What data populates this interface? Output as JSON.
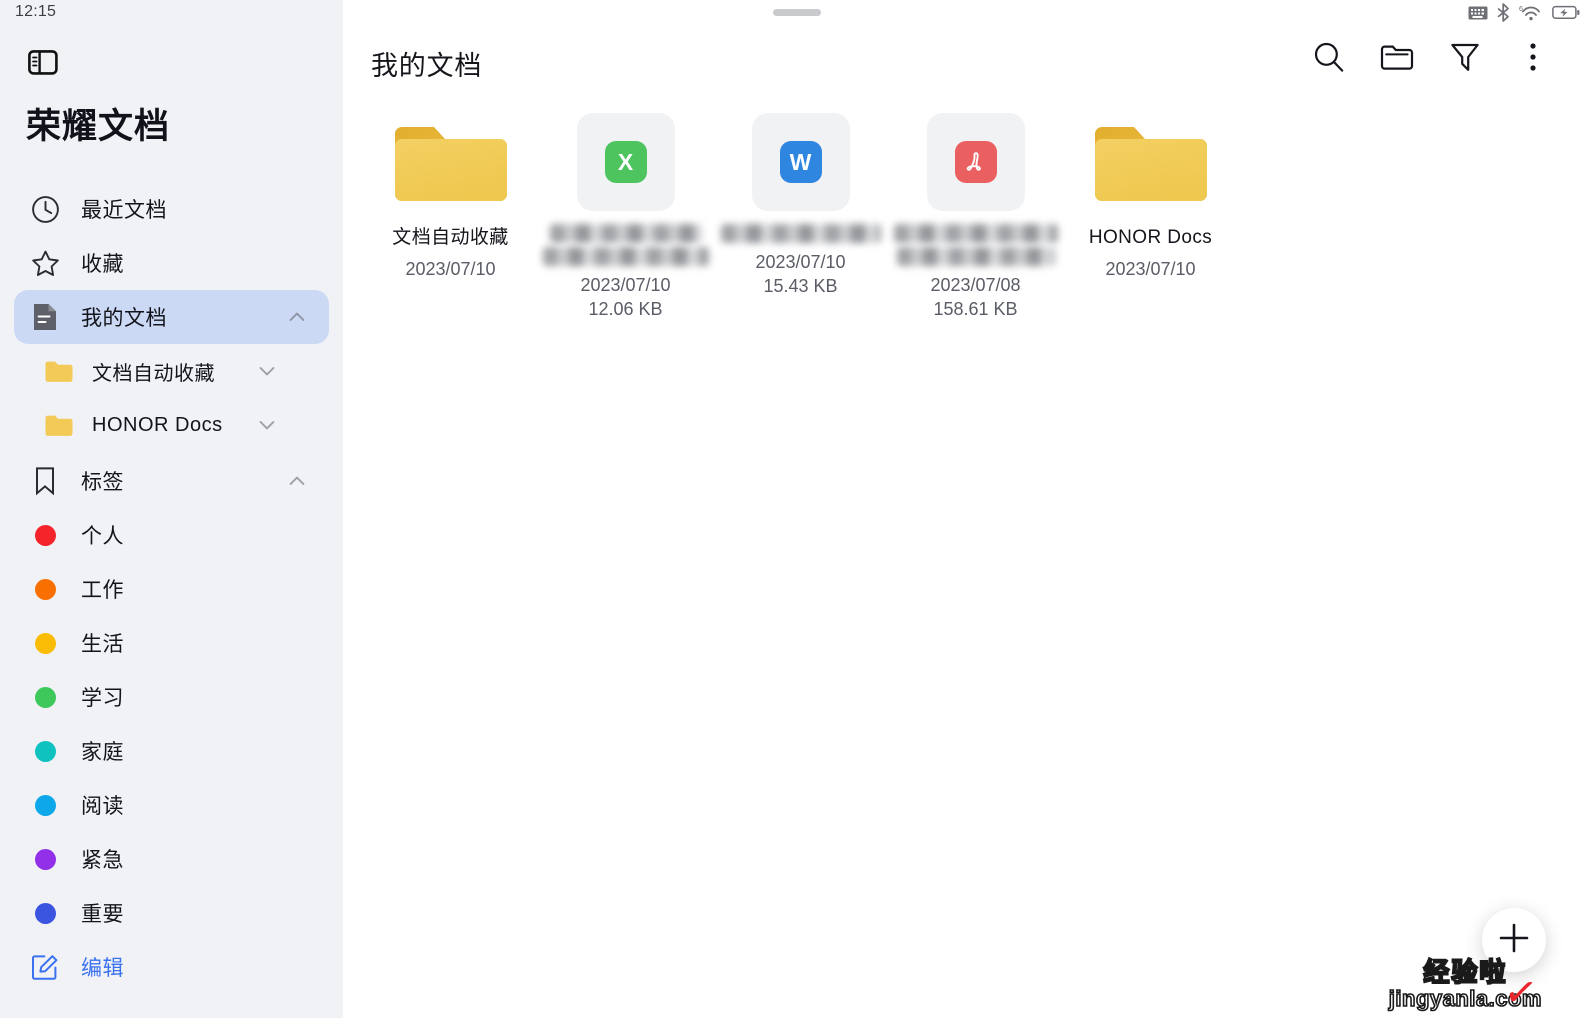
{
  "statusbar": {
    "time": "12:15",
    "icons": [
      "keyboard-icon",
      "bluetooth-icon",
      "wifi-icon",
      "battery-charging-icon"
    ],
    "wifi_label": "6"
  },
  "sidebar": {
    "panel_toggle_icon": "panel-left-icon",
    "app_title": "荣耀文档",
    "items": [
      {
        "label": "最近文档",
        "icon": "clock-icon",
        "selected": false,
        "chevron": ""
      },
      {
        "label": "收藏",
        "icon": "star-icon",
        "selected": false,
        "chevron": ""
      },
      {
        "label": "我的文档",
        "icon": "document-icon",
        "selected": true,
        "chevron": "up"
      },
      {
        "label": "文档自动收藏",
        "icon": "folder-icon",
        "selected": false,
        "chevron": "down",
        "sub": true
      },
      {
        "label": "HONOR Docs",
        "icon": "folder-icon",
        "selected": false,
        "chevron": "down",
        "sub": true
      },
      {
        "label": "标签",
        "icon": "bookmark-icon",
        "selected": false,
        "chevron": "up"
      }
    ],
    "tags": [
      {
        "label": "个人",
        "color": "#f5242a"
      },
      {
        "label": "工作",
        "color": "#fa7000"
      },
      {
        "label": "生活",
        "color": "#fbbc05"
      },
      {
        "label": "学习",
        "color": "#3ec75a"
      },
      {
        "label": "家庭",
        "color": "#0fc2c0"
      },
      {
        "label": "阅读",
        "color": "#0ca8ea"
      },
      {
        "label": "紧急",
        "color": "#9130e8"
      },
      {
        "label": "重要",
        "color": "#3b55e0"
      }
    ],
    "edit": {
      "label": "编辑",
      "icon": "edit-square-icon",
      "color": "#3a71f0"
    }
  },
  "main": {
    "title": "我的文档",
    "toolbar": [
      {
        "name": "search-icon",
        "label": "搜索"
      },
      {
        "name": "new-folder-icon",
        "label": "新建文件夹"
      },
      {
        "name": "filter-icon",
        "label": "筛选"
      },
      {
        "name": "more-vertical-icon",
        "label": "更多"
      }
    ],
    "files": [
      {
        "kind": "folder",
        "name": "文档自动收藏",
        "date": "2023/07/10",
        "size": "",
        "redacted": false
      },
      {
        "kind": "excel",
        "badge": "X",
        "badge_color": "#4ec45f",
        "name": "",
        "date": "2023/07/10",
        "size": "12.06 KB",
        "redacted": true,
        "redacted_lines": 2
      },
      {
        "kind": "word",
        "badge": "W",
        "badge_color": "#2f86e0",
        "name": "",
        "date": "2023/07/10",
        "size": "15.43 KB",
        "redacted": true,
        "redacted_lines": 1
      },
      {
        "kind": "pdf",
        "badge": "A",
        "badge_color": "#ea6060",
        "name": "",
        "date": "2023/07/08",
        "size": "158.61 KB",
        "redacted": true,
        "redacted_lines": 2
      },
      {
        "kind": "folder",
        "name": "HONOR Docs",
        "date": "2023/07/10",
        "size": "",
        "redacted": false
      }
    ],
    "fab": {
      "icon": "plus-icon",
      "label": "新建"
    }
  },
  "watermark": {
    "cn": "经验啦",
    "url": "jingyanla.com",
    "check": "✓"
  },
  "colors": {
    "sidebar_bg": "#f1f2f6",
    "main_bg": "#ffffff",
    "selected_bg": "#ccd9f5",
    "accent": "#3a71f0",
    "folder_yellow": "#f2cb4e"
  }
}
